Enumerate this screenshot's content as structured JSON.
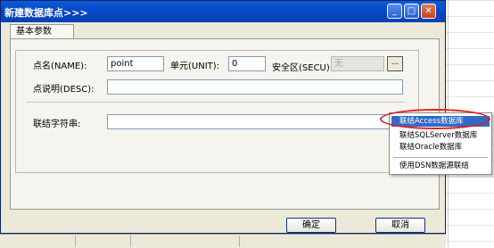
{
  "window": {
    "title": "新建数据库点>>>",
    "tab_label": "基本参数",
    "fields": {
      "name_label": "点名(NAME):",
      "name_value": "point",
      "unit_label": "单元(UNIT):",
      "unit_value": "0",
      "secu_label": "安全区(SECU)",
      "secu_value": "无",
      "ellipsis": "...",
      "desc_label": "点说明(DESC):",
      "desc_value": "",
      "conn_label": "联结字符串:",
      "conn_value": ""
    },
    "buttons": {
      "ok": "确定",
      "cancel": "取消"
    },
    "titlebar_buttons": {
      "minimize": "_",
      "maximize": "□",
      "close": "✕"
    }
  },
  "context_menu": {
    "items": [
      {
        "label": "联结Access数据库",
        "selected": true
      },
      {
        "label": "联结SQLServer数据库",
        "selected": false
      },
      {
        "label": "联结Oracle数据库",
        "selected": false
      },
      {
        "label": "使用DSN数据源联结",
        "selected": false
      }
    ]
  },
  "background": {
    "footer_cells": [
      "",
      "",
      ""
    ]
  },
  "colors": {
    "titlebar": "#0a5cd8",
    "menu_highlight": "#316ac5",
    "annotation": "#e02020"
  }
}
